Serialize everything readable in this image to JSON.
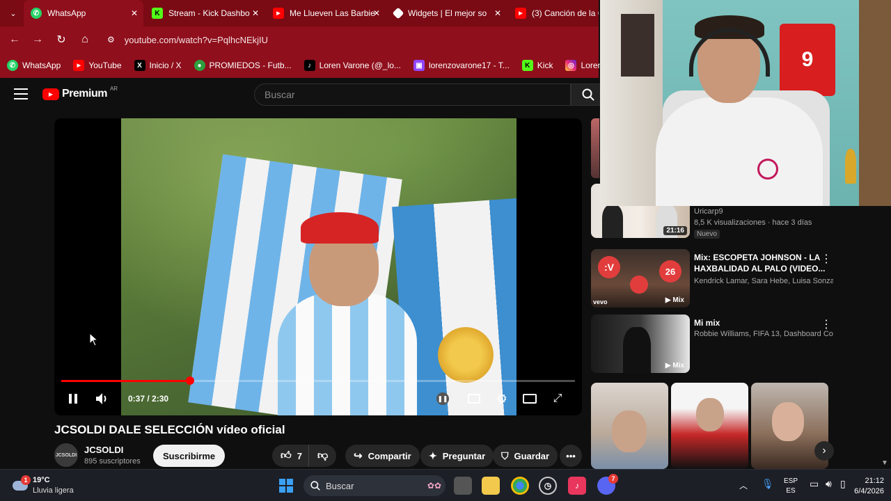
{
  "browser": {
    "tabs": [
      {
        "label": "WhatsApp",
        "icon": "whatsapp-icon",
        "color": "#25D366"
      },
      {
        "label": "Stream - Kick Dashbo",
        "icon": "kick-icon",
        "color": "#53FC18"
      },
      {
        "label": "Me Llueven Las Barbie",
        "icon": "youtube-icon",
        "color": "#FF0000"
      },
      {
        "label": "Widgets | El mejor so",
        "icon": "widgets-icon",
        "color": "#FFFFFF"
      },
      {
        "label": "(3) Canción de la Co",
        "icon": "youtube-icon",
        "color": "#FF0000"
      }
    ],
    "url": "youtube.com/watch?v=PqlhcNEkjIU",
    "bookmarks": [
      {
        "label": "WhatsApp",
        "icon": "whatsapp-icon"
      },
      {
        "label": "YouTube",
        "icon": "youtube-icon"
      },
      {
        "label": "Inicio / X",
        "icon": "x-icon"
      },
      {
        "label": "PROMIEDOS - Futb...",
        "icon": "promiedos-icon"
      },
      {
        "label": "Loren Varone (@_lo...",
        "icon": "tiktok-icon"
      },
      {
        "label": "lorenzovarone17 - T...",
        "icon": "twitch-icon"
      },
      {
        "label": "Kick",
        "icon": "kick-icon"
      },
      {
        "label": "Lorenzovarone (In",
        "icon": "instagram-icon"
      }
    ]
  },
  "youtube": {
    "logo": "Premium",
    "logo_region": "AR",
    "search_placeholder": "Buscar",
    "video": {
      "time": "0:37 / 2:30",
      "progress": 0.25,
      "title": "JCSOLDI DALE SELECCIÓN vídeo oficial"
    },
    "channel": {
      "name": "JCSOLDI",
      "subs": "895 suscriptores",
      "avatar_text": "JCSOLDI",
      "subscribe": "Suscribirme"
    },
    "actions": {
      "likes": "7",
      "share": "Compartir",
      "ask": "Preguntar",
      "save": "Guardar"
    },
    "recommendations": [
      {
        "title": "",
        "channel": "Uricarp9",
        "meta": "8,5 K visualizaciones · hace 3 días",
        "badge": "21:16",
        "tag": "Nuevo"
      },
      {
        "title": "Mix: ESCOPETA JOHNSON - LA HAXBALIDAD AL PALO (VIDEO...",
        "meta": "Kendrick Lamar, Sara Hebe, Luisa Sonza ...",
        "badge": "Mix"
      },
      {
        "title": "Mi mix",
        "meta": "Robbie Williams, FIFA 13, Dashboard Co...",
        "badge": "Mix"
      }
    ]
  },
  "taskbar": {
    "weather_temp": "19°C",
    "weather_desc": "Lluvia ligera",
    "weather_badge": "1",
    "search": "Buscar",
    "lang_top": "ESP",
    "lang_bottom": "ES",
    "time": "21:12",
    "date": "6/4/2026",
    "discord_badge": "7"
  }
}
